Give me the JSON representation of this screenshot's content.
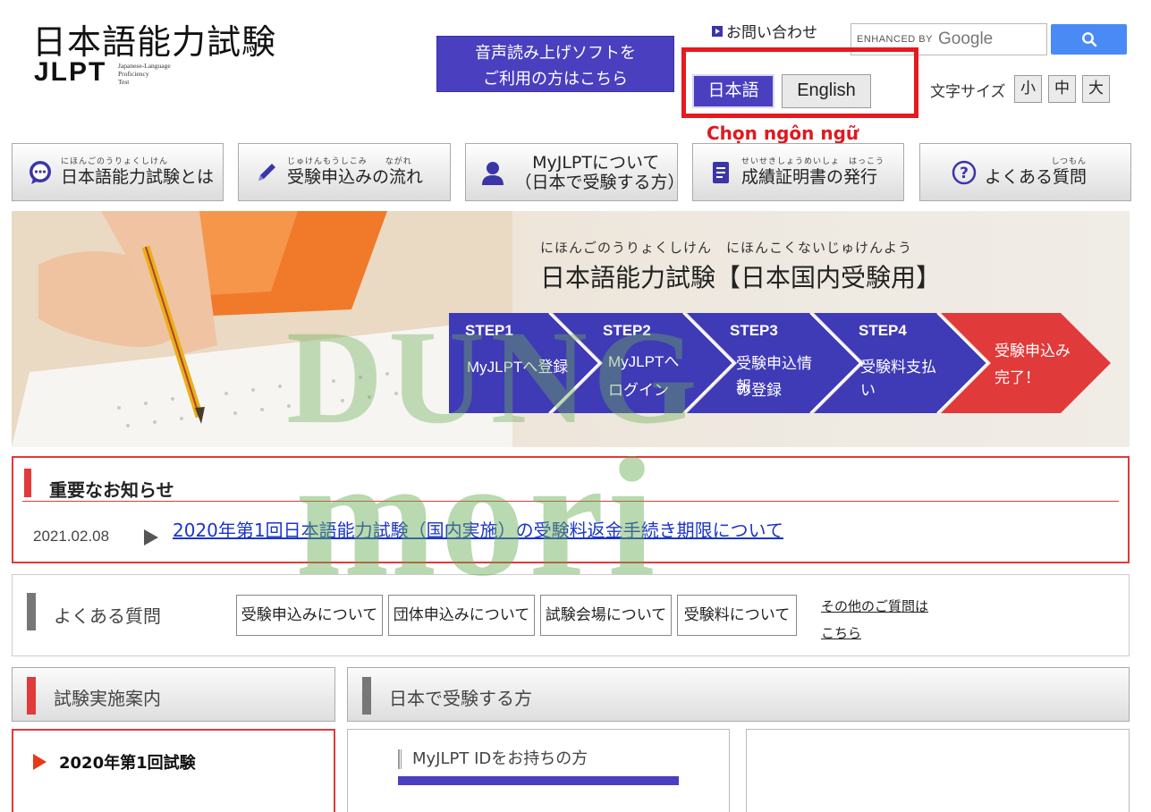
{
  "header": {
    "logo_jp": "日本語能力試験",
    "logo_en": "JLPT",
    "logo_sub": [
      "Japanese-Language",
      "Proficiency",
      "Test"
    ],
    "voice_line1": "音声読み上げソフトを",
    "voice_line2": "ご利用の方はこちら",
    "contact": "お問い合わせ",
    "search_enhanced": "ENHANCED BY",
    "search_google": "Google",
    "lang_jp": "日本語",
    "lang_en": "English",
    "choose_language": "Chọn ngôn ngữ",
    "font_size_label": "文字サイズ",
    "font_small": "小",
    "font_medium": "中",
    "font_large": "大"
  },
  "nav": [
    {
      "ruby": "にほんごのうりょくしけん",
      "label": "日本語能力試験とは",
      "icon": "chat-bubble-icon"
    },
    {
      "ruby": "じゅけんもうしこみ　　ながれ",
      "label": "受験申込みの流れ",
      "icon": "pencil-icon"
    },
    {
      "ruby": "",
      "label_line1": "MyJLPTについて",
      "label_line2": "（日本で受験する方）",
      "icon": "user-icon"
    },
    {
      "ruby": "せいせきしょうめいしょ　はっこう",
      "label": "成績証明書の発行",
      "icon": "document-icon"
    },
    {
      "ruby": "しつもん",
      "label": "よくある質問",
      "icon": "question-icon"
    }
  ],
  "banner": {
    "title_ruby": "にほんごのうりょくしけん　にほんこくないじゅけんよう",
    "title": "日本語能力試験【日本国内受験用】",
    "steps": [
      {
        "num": "STEP1",
        "desc1": "MyJLPTへ登録",
        "desc2": ""
      },
      {
        "num": "STEP2",
        "desc1": "MyJLPTへ",
        "desc2": "ログイン"
      },
      {
        "num": "STEP3",
        "desc1": "受験申込情報",
        "desc2": "の登録"
      },
      {
        "num": "STEP4",
        "desc1": "受験料支払い",
        "desc2": ""
      },
      {
        "num": "",
        "desc1": "受験申込み",
        "desc2": "完了！"
      }
    ]
  },
  "notice": {
    "title": "重要なお知らせ",
    "date": "2021.02.08",
    "link": "2020年第1回日本語能力試験（国内実施）の受験料返金手続き期限について"
  },
  "faq": {
    "title": "よくある質問",
    "buttons": [
      "受験申込みについて",
      "団体申込みについて",
      "試験会場について",
      "受験料について"
    ],
    "other_line1": "その他のご質問は",
    "other_line2": "こちら"
  },
  "sections": {
    "exam_info": "試験実施案内",
    "japan_exam": "日本で受験する方",
    "exam_item": "2020年第1回試験",
    "myid": "MyJLPT IDをお持ちの方"
  },
  "watermark": {
    "line1": "DUNG",
    "line2": "mori"
  },
  "colors": {
    "brand": "#4a3fbf",
    "accent_red": "#e03a3a",
    "link": "#1a35c8"
  }
}
